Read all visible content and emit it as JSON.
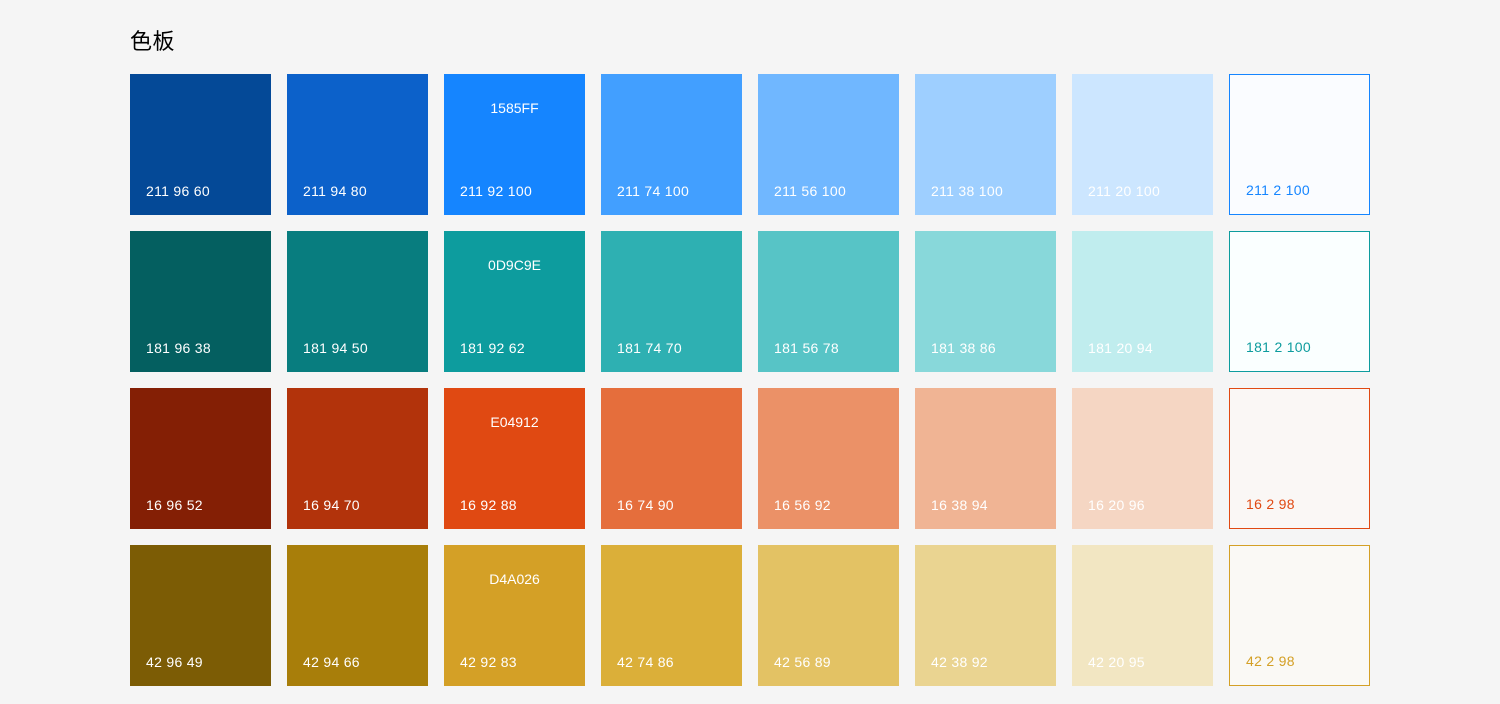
{
  "title": "色板",
  "rows": [
    {
      "name": "blue",
      "swatches": [
        {
          "bg": "#044997",
          "hsb": "211 96 60",
          "textColor": "#ffffff"
        },
        {
          "bg": "#0C61CA",
          "hsb": "211 94 80",
          "textColor": "#ffffff"
        },
        {
          "bg": "#1585FF",
          "hex": "1585FF",
          "hsb": "211 92 100",
          "textColor": "#ffffff"
        },
        {
          "bg": "#429FFF",
          "hsb": "211 74 100",
          "textColor": "#ffffff"
        },
        {
          "bg": "#70B7FF",
          "hsb": "211 56 100",
          "textColor": "#ffffff"
        },
        {
          "bg": "#9ECFFF",
          "hsb": "211 38 100",
          "textColor": "#ffffff"
        },
        {
          "bg": "#CCE6FF",
          "hsb": "211 20 100",
          "textColor": "#ffffff"
        },
        {
          "bg": "#FAFCFF",
          "hsb": "211 2 100",
          "textColor": "#1585FF",
          "border": "#1585FF"
        }
      ]
    },
    {
      "name": "teal",
      "swatches": [
        {
          "bg": "#045F60",
          "hsb": "181 96 38",
          "textColor": "#ffffff"
        },
        {
          "bg": "#087D7F",
          "hsb": "181 94 50",
          "textColor": "#ffffff"
        },
        {
          "bg": "#0D9C9E",
          "hex": "0D9C9E",
          "hsb": "181 92 62",
          "textColor": "#ffffff"
        },
        {
          "bg": "#2EB0B2",
          "hsb": "181 74 70",
          "textColor": "#ffffff"
        },
        {
          "bg": "#57C4C6",
          "hsb": "181 56 78",
          "textColor": "#ffffff"
        },
        {
          "bg": "#88D8DA",
          "hsb": "181 38 86",
          "textColor": "#ffffff"
        },
        {
          "bg": "#C0EDEE",
          "hsb": "181 20 94",
          "textColor": "#ffffff"
        },
        {
          "bg": "#FAFFFF",
          "hsb": "181 2 100",
          "textColor": "#0D9C9E",
          "border": "#0D9C9E"
        }
      ]
    },
    {
      "name": "orange-red",
      "swatches": [
        {
          "bg": "#841F05",
          "hsb": "16 96 52",
          "textColor": "#ffffff"
        },
        {
          "bg": "#B2330B",
          "hsb": "16 94 70",
          "textColor": "#ffffff"
        },
        {
          "bg": "#E04912",
          "hex": "E04912",
          "hsb": "16 92 88",
          "textColor": "#ffffff"
        },
        {
          "bg": "#E56E3C",
          "hsb": "16 74 90",
          "textColor": "#ffffff"
        },
        {
          "bg": "#EB9167",
          "hsb": "16 56 92",
          "textColor": "#ffffff"
        },
        {
          "bg": "#F0B494",
          "hsb": "16 38 94",
          "textColor": "#ffffff"
        },
        {
          "bg": "#F5D6C3",
          "hsb": "16 20 96",
          "textColor": "#ffffff"
        },
        {
          "bg": "#FAF7F5",
          "hsb": "16 2 98",
          "textColor": "#E04912",
          "border": "#E04912"
        }
      ]
    },
    {
      "name": "amber",
      "swatches": [
        {
          "bg": "#7C5C05",
          "hsb": "42 96 49",
          "textColor": "#ffffff"
        },
        {
          "bg": "#A87E0A",
          "hsb": "42 94 66",
          "textColor": "#ffffff"
        },
        {
          "bg": "#D4A026",
          "hex": "D4A026",
          "hsb": "42 92 83",
          "textColor": "#ffffff"
        },
        {
          "bg": "#DBAF39",
          "hsb": "42 74 86",
          "textColor": "#ffffff"
        },
        {
          "bg": "#E3C264",
          "hsb": "42 56 89",
          "textColor": "#ffffff"
        },
        {
          "bg": "#EAD491",
          "hsb": "42 38 92",
          "textColor": "#ffffff"
        },
        {
          "bg": "#F2E6C2",
          "hsb": "42 20 95",
          "textColor": "#ffffff"
        },
        {
          "bg": "#FAF9F5",
          "hsb": "42 2 98",
          "textColor": "#D4A026",
          "border": "#D4A026"
        }
      ]
    }
  ]
}
